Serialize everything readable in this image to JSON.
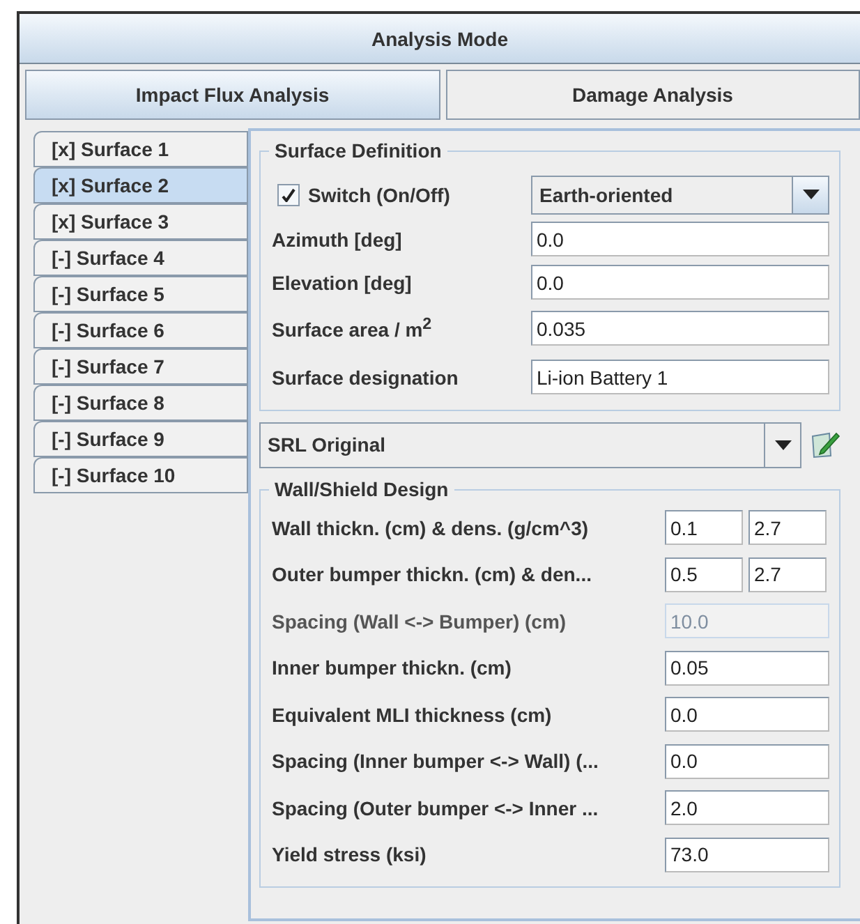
{
  "title": "Analysis Mode",
  "modes": [
    {
      "label": "Impact Flux Analysis",
      "selected": true
    },
    {
      "label": "Damage Analysis",
      "selected": false
    }
  ],
  "surfaces": [
    {
      "label": "[x] Surface 1",
      "selected": false
    },
    {
      "label": "[x] Surface 2",
      "selected": true
    },
    {
      "label": "[x] Surface 3",
      "selected": false
    },
    {
      "label": "[-] Surface 4",
      "selected": false
    },
    {
      "label": "[-] Surface 5",
      "selected": false
    },
    {
      "label": "[-] Surface 6",
      "selected": false
    },
    {
      "label": "[-] Surface 7",
      "selected": false
    },
    {
      "label": "[-] Surface 8",
      "selected": false
    },
    {
      "label": "[-] Surface 9",
      "selected": false
    },
    {
      "label": "[-] Surface 10",
      "selected": false
    }
  ],
  "surface_definition": {
    "title": "Surface Definition",
    "switch": {
      "label": "Switch (On/Off)",
      "checked": true
    },
    "orientation": "Earth-oriented",
    "fields": [
      {
        "label": "Azimuth [deg]",
        "value": "0.0"
      },
      {
        "label": "Elevation [deg]",
        "value": "0.0"
      },
      {
        "label": "Surface area / m$^{2}$",
        "value": "0.035"
      },
      {
        "label": "Surface designation",
        "value": "Li-ion Battery 1"
      }
    ]
  },
  "preset": "SRL Original",
  "wall_design": {
    "title": "Wall/Shield Design",
    "rows": [
      {
        "label": "Wall thickn. (cm) & dens. (g/cm^3)",
        "values": [
          "0.1",
          "2.7"
        ],
        "disabled": false
      },
      {
        "label": "Outer bumper thickn. (cm) & den...",
        "values": [
          "0.5",
          "2.7"
        ],
        "disabled": false
      },
      {
        "label": "Spacing (Wall <-> Bumper) (cm)",
        "values": [
          "10.0"
        ],
        "disabled": true
      },
      {
        "label": "Inner bumper thickn. (cm)",
        "values": [
          "0.05"
        ],
        "disabled": false
      },
      {
        "label": "Equivalent MLI thickness (cm)",
        "values": [
          "0.0"
        ],
        "disabled": false
      },
      {
        "label": "Spacing (Inner bumper <-> Wall) (...",
        "values": [
          "0.0"
        ],
        "disabled": false
      },
      {
        "label": "Spacing (Outer bumper <-> Inner ...",
        "values": [
          "2.0"
        ],
        "disabled": false
      },
      {
        "label": "Yield stress (ksi)",
        "values": [
          "73.0"
        ],
        "disabled": false
      }
    ]
  }
}
